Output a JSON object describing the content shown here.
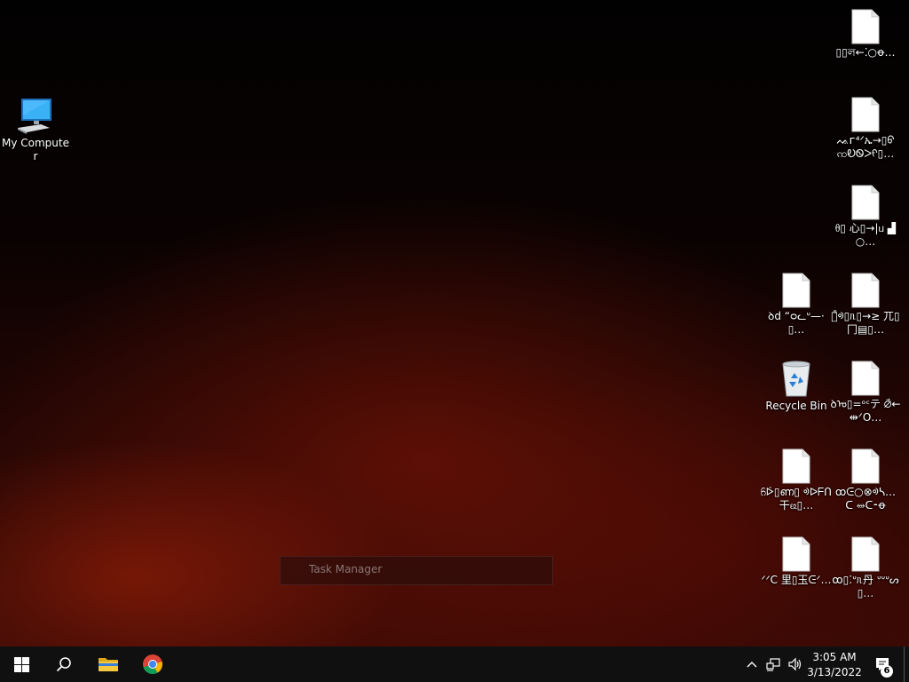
{
  "desktop": {
    "left_icons": [
      {
        "label": "My Computer",
        "icon": "computer-icon"
      }
    ],
    "recycle_bin": {
      "label": "Recycle Bin",
      "icon": "recycle-bin-icon"
    },
    "files": [
      {
        "label": "▯▯ল←⁚○ꝋ…"
      },
      {
        "label": "ᨕᴦ⁴ᐟኤ→▯ᠪ ꩡᎧᏫᐳᠻ▯…"
      },
      {
        "label": "ᦲ▯ 心▯→|ᥙ ▟○…"
      },
      {
        "label": "ꝺd “ᴑᓚᐡ—·▯…"
      },
      {
        "label": "ᦀ̊ᢀ▯ᥰ▯→≥ 兀▯冂▤▯…"
      },
      {
        "label": "ꝺᠣ▯=ᵒᶜテ ⦳←⇹ᐟO…"
      },
      {
        "label": "ᦆᢰ▯ണ▯ ᢀᐅᖴᑎ干ᦕ▯…"
      },
      {
        "label": "ꝏᕮ○⊗ᢀᓴ… ᑕ ⥈ᑕ⁃ꝋ"
      },
      {
        "label": "ᐟᐟC 里▯玉ᕮᐟ…"
      },
      {
        "label": "ꝏ▯⁚ᐡᥰ丹 ᐡᐡᐡᔕ▯…"
      }
    ]
  },
  "ghost_window": {
    "title": "Task Manager"
  },
  "taskbar": {
    "apps": [
      {
        "name": "start",
        "icon": "windows-logo-icon"
      },
      {
        "name": "search",
        "icon": "search-icon"
      },
      {
        "name": "file-explorer",
        "icon": "folder-icon"
      },
      {
        "name": "chrome",
        "icon": "chrome-icon"
      }
    ],
    "tray": {
      "time": "3:05 AM",
      "date": "3/13/2022",
      "notification_count": "6"
    }
  },
  "colors": {
    "taskbar_bg": "#101010",
    "monitor_blue": "#2fa3f2",
    "folder_yellow": "#f2c230",
    "chrome_red": "#db4437",
    "chrome_green": "#0f9d58",
    "chrome_yellow": "#f4b400",
    "chrome_blue": "#4285f4"
  }
}
